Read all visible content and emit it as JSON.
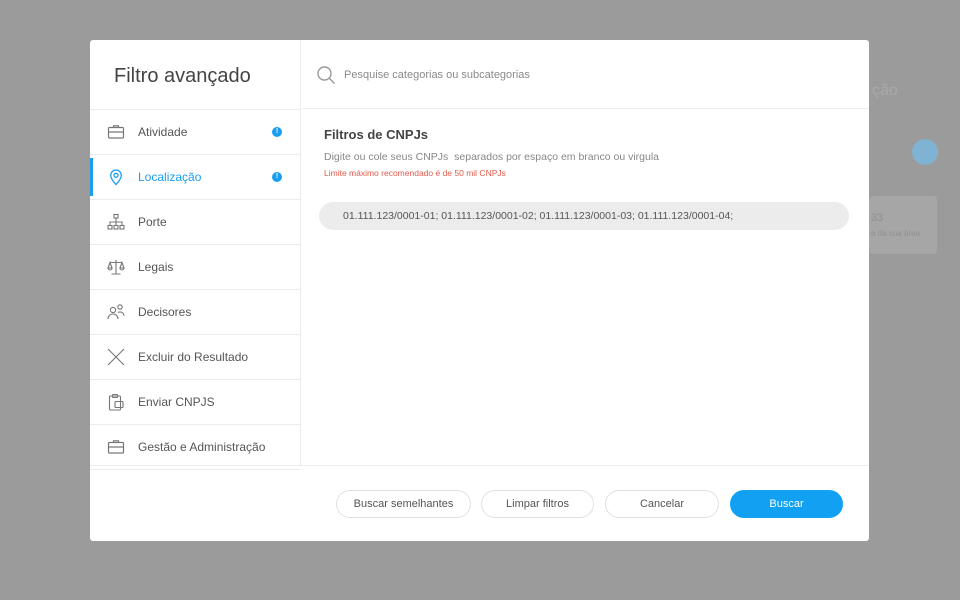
{
  "background": {
    "title": "ção",
    "card_number": "33",
    "card_sub": "a da sua área"
  },
  "modal": {
    "title": "Filtro avançado"
  },
  "sidebar": {
    "items": [
      {
        "label": "Atividade",
        "icon": "briefcase-icon",
        "badge": "!"
      },
      {
        "label": "Localização",
        "icon": "map-pin-icon",
        "badge": "!",
        "active": true
      },
      {
        "label": "Porte",
        "icon": "org-chart-icon"
      },
      {
        "label": "Legais",
        "icon": "scales-icon"
      },
      {
        "label": "Decisores",
        "icon": "people-icon"
      },
      {
        "label": "Excluir do Resultado",
        "icon": "x-icon"
      },
      {
        "label": "Enviar CNPJS",
        "icon": "clipboard-icon"
      },
      {
        "label": "Gestão e Administração",
        "icon": "briefcase-icon"
      }
    ]
  },
  "search": {
    "placeholder": "Pesquise categorias ou subcategorias",
    "value": ""
  },
  "content": {
    "title": "Filtros de CNPJs",
    "description": "Digite ou cole seus CNPJs  separados por espaço em branco ou virgula",
    "warning": "Limite máximo recomendado é de 50 mil CNPJs",
    "cnpj_value": "01.111.123/0001-01; 01.111.123/0001-02; 01.111.123/0001-03; 01.111.123/0001-04;"
  },
  "footer": {
    "similar_label": "Buscar semelhantes",
    "clear_label": "Limpar filtros",
    "cancel_label": "Cancelar",
    "search_label": "Buscar"
  },
  "colors": {
    "accent": "#1a9ef0",
    "warning": "#e25b4b",
    "overlay": "#9b9b9b"
  }
}
